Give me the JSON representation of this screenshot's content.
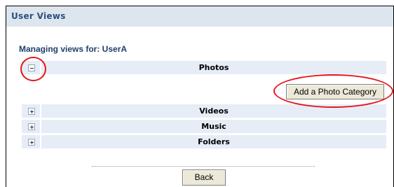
{
  "panel": {
    "title": "User Views"
  },
  "managing_label": "Managing views for: UserA",
  "sections": [
    {
      "label": "Photos",
      "expanded": true,
      "toggle_icon": "minus-icon"
    },
    {
      "label": "Videos",
      "expanded": false,
      "toggle_icon": "plus-icon"
    },
    {
      "label": "Music",
      "expanded": false,
      "toggle_icon": "plus-icon"
    },
    {
      "label": "Folders",
      "expanded": false,
      "toggle_icon": "plus-icon"
    }
  ],
  "actions": {
    "add_photo_category": "Add a Photo Category",
    "back": "Back"
  },
  "colors": {
    "title_bar": "#dde6ef",
    "row_background": "#e6edf6",
    "highlight_ring": "#e8141a"
  }
}
